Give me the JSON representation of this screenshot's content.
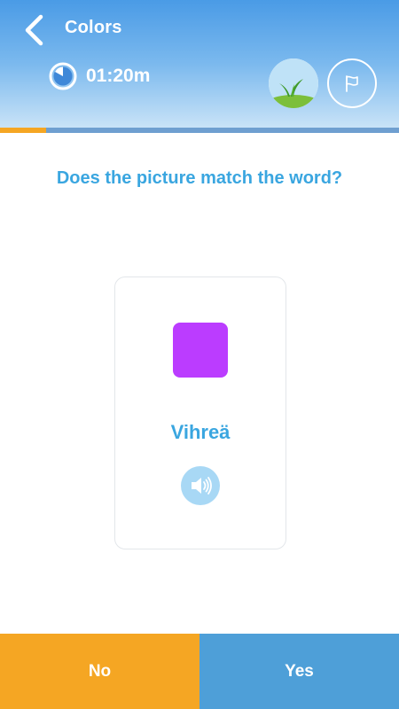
{
  "header": {
    "title": "Colors",
    "timer": "01:20m",
    "back_icon": "chevron-left-icon",
    "timer_icon": "timer-icon",
    "level_icon": "grass-icon",
    "flag_icon": "flag-icon"
  },
  "progress": {
    "fraction": 0.115
  },
  "question": "Does the picture match the word?",
  "card": {
    "swatch_color": "#bb3cff",
    "word": "Vihreä",
    "sound_icon": "speaker-icon"
  },
  "buttons": {
    "no_label": "No",
    "yes_label": "Yes"
  },
  "colors": {
    "accent": "#3aa6e0",
    "no_button": "#f5a623",
    "yes_button": "#4e9fd8"
  }
}
